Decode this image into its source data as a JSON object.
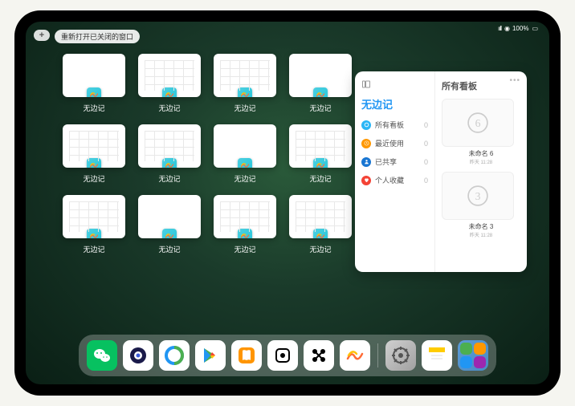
{
  "status": {
    "battery": "100%"
  },
  "toolbar": {
    "add_label": "+",
    "reopen_label": "重新打开已关闭的窗口"
  },
  "app_name": "无边记",
  "windows": [
    {
      "label": "无边记",
      "variant": "blank"
    },
    {
      "label": "无边记",
      "variant": "grid"
    },
    {
      "label": "无边记",
      "variant": "grid"
    },
    {
      "label": "无边记",
      "variant": "blank"
    },
    {
      "label": "无边记",
      "variant": "grid"
    },
    {
      "label": "无边记",
      "variant": "grid"
    },
    {
      "label": "无边记",
      "variant": "blank"
    },
    {
      "label": "无边记",
      "variant": "grid"
    },
    {
      "label": "无边记",
      "variant": "grid"
    },
    {
      "label": "无边记",
      "variant": "blank"
    },
    {
      "label": "无边记",
      "variant": "grid"
    },
    {
      "label": "无边记",
      "variant": "grid"
    }
  ],
  "panel": {
    "left_title": "无边记",
    "right_title": "所有看板",
    "categories": [
      {
        "label": "所有看板",
        "count": 0,
        "color": "#29b6f6",
        "icon": "circle"
      },
      {
        "label": "最近使用",
        "count": 0,
        "color": "#ff9800",
        "icon": "clock"
      },
      {
        "label": "已共享",
        "count": 0,
        "color": "#1976d2",
        "icon": "person"
      },
      {
        "label": "个人收藏",
        "count": 0,
        "color": "#f44336",
        "icon": "heart"
      }
    ],
    "boards": [
      {
        "label": "未命名 6",
        "sub": "昨天 11:28",
        "digit": "6"
      },
      {
        "label": "未命名 3",
        "sub": "昨天 11:28",
        "digit": "3"
      }
    ]
  },
  "dock": [
    {
      "name": "wechat",
      "bg": "green"
    },
    {
      "name": "quark",
      "bg": "white"
    },
    {
      "name": "qqbrowser",
      "bg": "white"
    },
    {
      "name": "playstore",
      "bg": "white"
    },
    {
      "name": "books",
      "bg": "white"
    },
    {
      "name": "dice",
      "bg": "white"
    },
    {
      "name": "connect",
      "bg": "white"
    },
    {
      "name": "freeform",
      "bg": "white"
    },
    {
      "name": "settings",
      "bg": "gray-grad"
    },
    {
      "name": "notes",
      "bg": "white"
    },
    {
      "name": "recents",
      "bg": "blue-grad"
    }
  ]
}
